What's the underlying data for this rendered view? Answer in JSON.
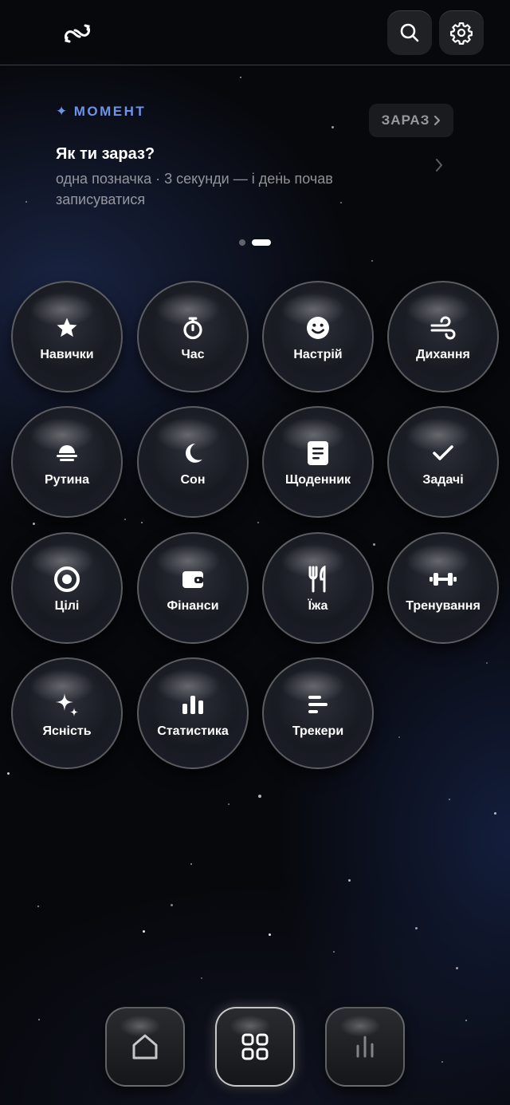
{
  "header": {
    "logo_icon": "infinity-link-icon",
    "search_icon": "search-icon",
    "settings_icon": "gear-icon"
  },
  "moment": {
    "tag": "МОМЕНТ",
    "now_label": "ЗАРАЗ",
    "title": "Як ти зараз?",
    "subtitle": "одна позначка · 3 секунди — і день почав записуватися"
  },
  "carousel": {
    "count": 2,
    "active": 1
  },
  "modules": [
    {
      "label": "Навички",
      "icon": "star-icon"
    },
    {
      "label": "Час",
      "icon": "stopwatch-icon"
    },
    {
      "label": "Настрій",
      "icon": "smile-icon"
    },
    {
      "label": "Дихання",
      "icon": "wind-icon"
    },
    {
      "label": "Рутина",
      "icon": "sunrise-icon"
    },
    {
      "label": "Сон",
      "icon": "moon-icon"
    },
    {
      "label": "Щоденник",
      "icon": "notebook-icon"
    },
    {
      "label": "Задачі",
      "icon": "check-icon"
    },
    {
      "label": "Цілі",
      "icon": "target-icon"
    },
    {
      "label": "Фінанси",
      "icon": "wallet-icon"
    },
    {
      "label": "Їжа",
      "icon": "cutlery-icon"
    },
    {
      "label": "Тренування",
      "icon": "dumbbell-icon"
    },
    {
      "label": "Ясність",
      "icon": "sparkles-icon"
    },
    {
      "label": "Статистика",
      "icon": "bar-chart-icon"
    },
    {
      "label": "Трекери",
      "icon": "list-lines-icon"
    }
  ],
  "bottom_nav": [
    {
      "icon": "home-icon",
      "active": false
    },
    {
      "icon": "grid-icon",
      "active": true
    },
    {
      "icon": "stats-icon",
      "active": false
    }
  ],
  "colors": {
    "accent": "#6f93e6",
    "background": "#07080c"
  }
}
